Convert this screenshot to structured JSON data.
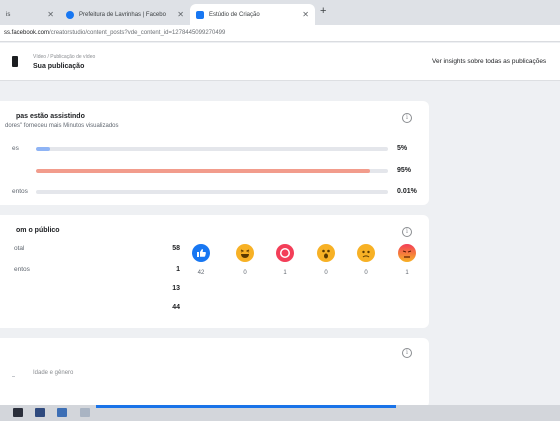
{
  "browser": {
    "tabs": [
      {
        "title": "is"
      },
      {
        "title": "Prefeitura de Lavrinhas | Facebo"
      },
      {
        "title": "Estúdio de Criação"
      }
    ],
    "url_prefix": "ss.facebook.com",
    "url_path": "/creatorstudio/content_posts?vde_content_id=1278445099270499"
  },
  "header": {
    "breadcrumb": "Vídeo / Publicação de vídeo",
    "title": "Sua publicação",
    "insights_link": "Ver insights sobre todas as publicações"
  },
  "watching_card": {
    "title": "pas estão assistindo",
    "subtitle": "dores\" forneceu mais Minutos visualizados",
    "rows": [
      {
        "label": "es",
        "percent": "5%",
        "fraction": 0.05,
        "color": "#8fb4f5"
      },
      {
        "label": "",
        "percent": "95%",
        "fraction": 0.95,
        "color": "#f29c8c"
      },
      {
        "label": "entos",
        "percent": "0.01%",
        "fraction": 0.0001,
        "color": "#c9ccd1"
      }
    ]
  },
  "engagement_card": {
    "title": "om o público",
    "stats": [
      {
        "label": "otal",
        "value": "58"
      },
      {
        "label": "entos",
        "value": "1"
      },
      {
        "label": "",
        "value": "13"
      },
      {
        "label": "",
        "value": "44"
      }
    ],
    "reactions": [
      {
        "name": "like",
        "count": "42",
        "color": "#1877f2"
      },
      {
        "name": "haha",
        "count": "0",
        "color": "#f7b125"
      },
      {
        "name": "love",
        "count": "1",
        "color": "#f33e58"
      },
      {
        "name": "wow",
        "count": "0",
        "color": "#f7b125"
      },
      {
        "name": "sad",
        "count": "0",
        "color": "#f7b125"
      },
      {
        "name": "angry",
        "count": "1",
        "color": "#e9710f"
      }
    ]
  },
  "demographics_card": {
    "tab_label": "Idade e gênero"
  }
}
